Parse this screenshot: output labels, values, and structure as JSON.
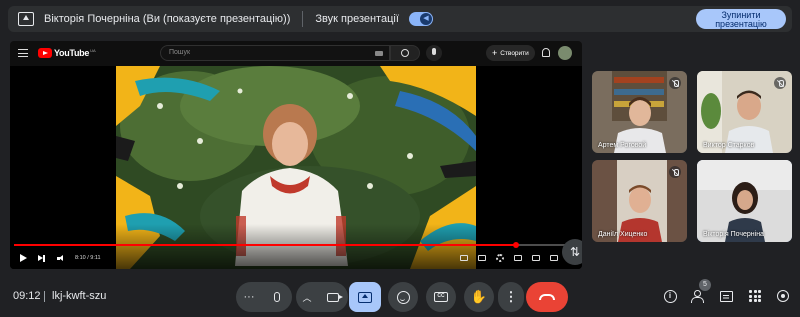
{
  "presentation_bar": {
    "title": "Вікторія Почерніна (Ви (показуєте презентацію))",
    "sound_label": "Звук презентації",
    "sound_enabled": true,
    "stop_button_label": "Зупинити презентацію"
  },
  "youtube": {
    "logo_text": "YouTube",
    "logo_region": "UA",
    "search_placeholder": "Пошук",
    "create_label": "Створити",
    "player": {
      "time": "8:10 / 9:11",
      "progress": 0.89
    }
  },
  "participants": [
    {
      "name": "Артем Роговой",
      "muted": true,
      "active": false
    },
    {
      "name": "Виктор Старков",
      "muted": true,
      "active": false
    },
    {
      "name": "Даніїл Хиценко",
      "muted": true,
      "active": false
    },
    {
      "name": "Вікторія Почерніна",
      "muted": false,
      "active": true
    }
  ],
  "bottom_bar": {
    "time": "09:12",
    "meeting_code": "lkj-kwft-szu",
    "more_label": "···",
    "participants_count": "5"
  },
  "colors": {
    "accent": "#a8c7fa",
    "hangup": "#ea4335",
    "youtube_red": "#ff0000",
    "background": "#202124",
    "control": "#3c4043"
  }
}
